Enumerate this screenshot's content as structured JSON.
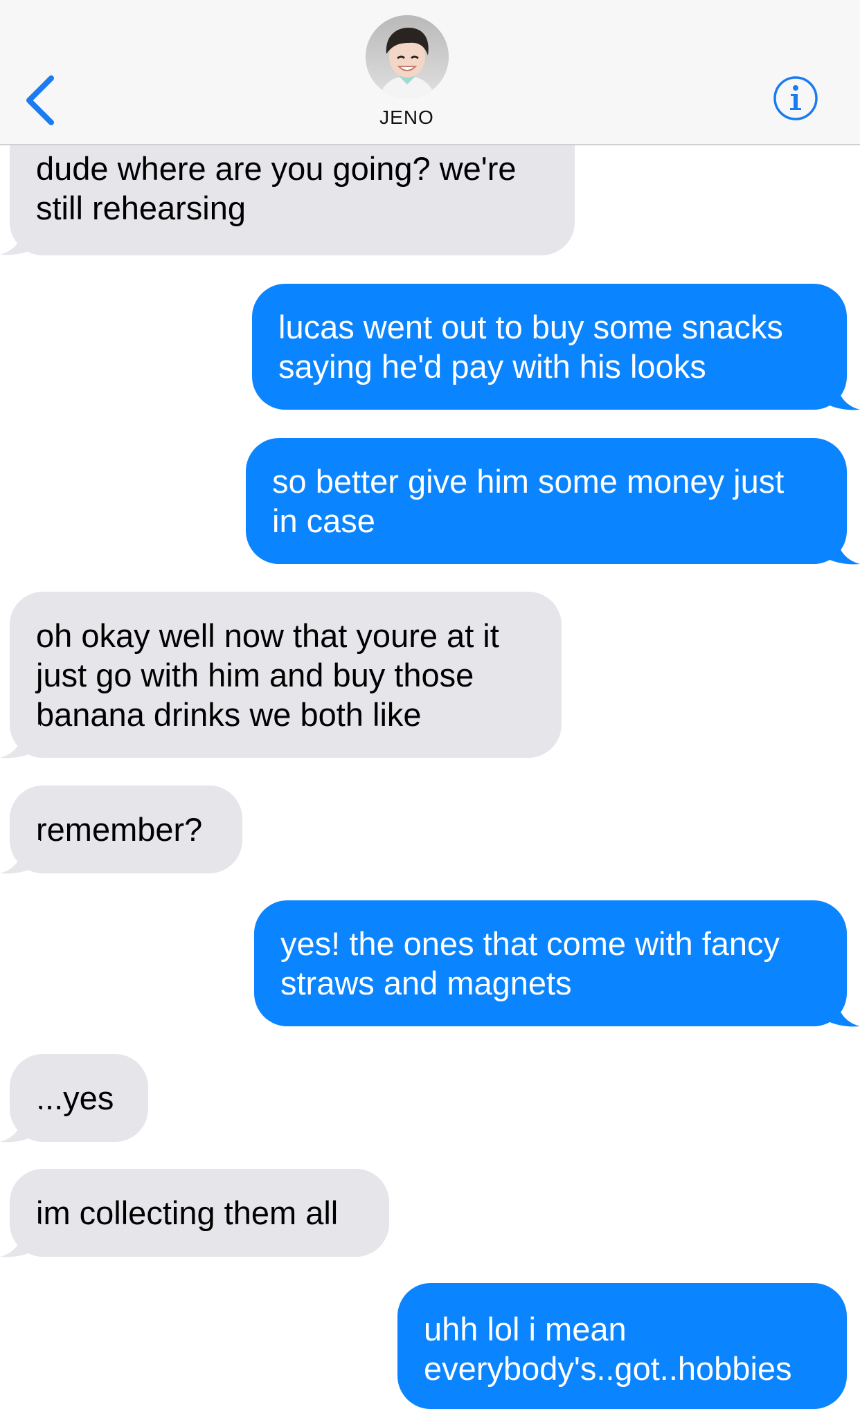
{
  "header": {
    "contact_name": "JENO",
    "back_icon": "chevron-left-icon",
    "info_icon": "info-icon",
    "accent_color": "#1a7cf0"
  },
  "colors": {
    "incoming_bubble": "#e5e5ea",
    "outgoing_bubble": "#0b84ff"
  },
  "messages": [
    {
      "from": "them",
      "lines": [
        "dude where are you going? we're",
        "still rehearsing"
      ]
    },
    {
      "from": "me",
      "lines": [
        "lucas went out to buy some snacks",
        "saying he'd pay with his looks"
      ]
    },
    {
      "from": "me",
      "lines": [
        "so better give him some money just",
        "in case"
      ]
    },
    {
      "from": "them",
      "lines": [
        "oh okay well now that youre at it",
        "just go with him and buy those",
        "banana drinks we both like"
      ]
    },
    {
      "from": "them",
      "lines": [
        "remember?"
      ]
    },
    {
      "from": "me",
      "lines": [
        "yes! the ones that come with fancy",
        "straws and magnets"
      ]
    },
    {
      "from": "them",
      "lines": [
        "...yes"
      ]
    },
    {
      "from": "them",
      "lines": [
        "im collecting them all"
      ]
    },
    {
      "from": "me",
      "lines": [
        "uhh lol i mean",
        "everybody's..got..hobbies"
      ]
    }
  ]
}
